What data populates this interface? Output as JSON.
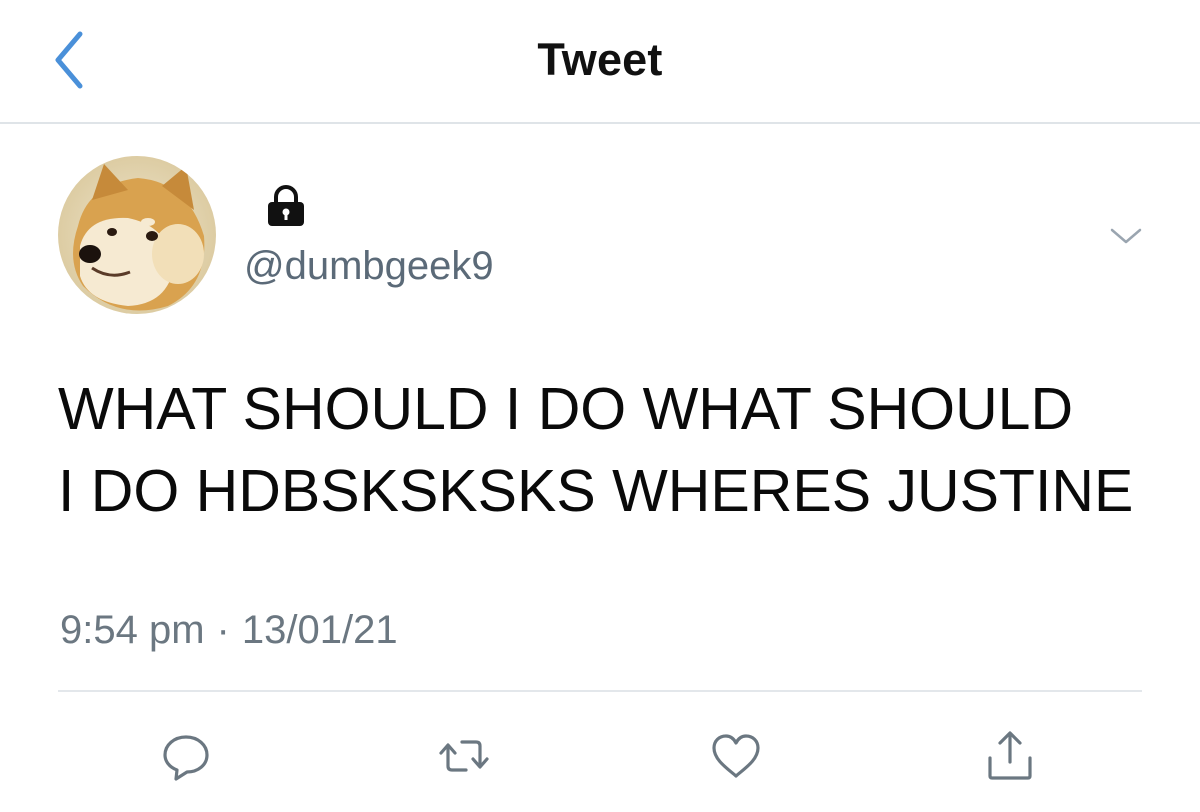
{
  "header": {
    "title": "Tweet",
    "back_icon": "chevron-left-icon",
    "accent_color": "#4a90d9"
  },
  "author": {
    "handle": "@dumbgeek9",
    "protected": true,
    "lock_icon": "lock-icon",
    "avatar_icon": "shiba-doge-avatar"
  },
  "tweet": {
    "line1": "WHAT SHOULD I DO WHAT SHOULD",
    "line2": "I DO HDBSKSKSKS WHERES JUSTINE"
  },
  "timestamp": {
    "time": "9:54 pm",
    "separator": "·",
    "date": "13/01/21"
  },
  "actions": [
    {
      "name": "reply",
      "icon": "reply-icon"
    },
    {
      "name": "retweet",
      "icon": "retweet-icon"
    },
    {
      "name": "like",
      "icon": "heart-icon"
    },
    {
      "name": "share",
      "icon": "share-icon"
    }
  ]
}
